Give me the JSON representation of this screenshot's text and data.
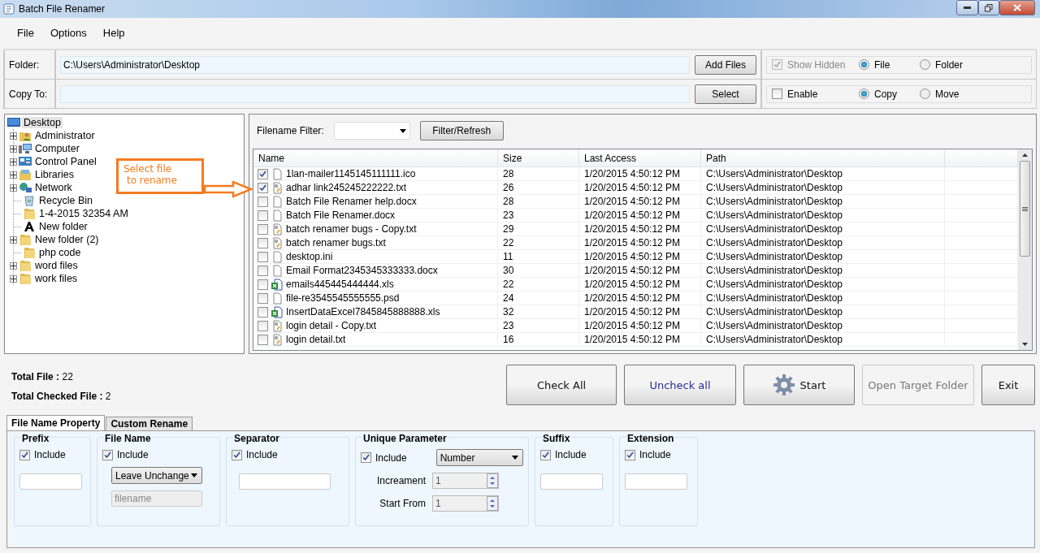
{
  "window": {
    "title": "Batch File Renamer"
  },
  "menu": [
    "File",
    "Options",
    "Help"
  ],
  "folder": {
    "label": "Folder:",
    "value": "C:\\Users\\Administrator\\Desktop",
    "button": "Add Files"
  },
  "copy_to": {
    "label": "Copy To:",
    "button": "Select"
  },
  "show_options": {
    "checkbox": {
      "label": "Show Hidden",
      "checked": true,
      "disabled": true
    },
    "choices": [
      {
        "label": "File",
        "selected": true
      },
      {
        "label": "Folder",
        "selected": false
      }
    ]
  },
  "copy_options": {
    "checkbox": {
      "label": "Enable",
      "checked": false,
      "disabled": false
    },
    "choices": [
      {
        "label": "Copy",
        "selected": true
      },
      {
        "label": "Move",
        "selected": false
      }
    ]
  },
  "tree": {
    "label": "Desktop",
    "kind": "desktop",
    "selected": true,
    "children": [
      {
        "label": "Administrator",
        "kind": "user",
        "expandable": true,
        "selected": false
      },
      {
        "label": "Computer",
        "kind": "computer",
        "expandable": true,
        "selected": false
      },
      {
        "label": "Control Panel",
        "kind": "control",
        "expandable": true,
        "selected": false
      },
      {
        "label": "Libraries",
        "kind": "library",
        "expandable": true,
        "selected": false
      },
      {
        "label": "Network",
        "kind": "network",
        "expandable": true,
        "selected": false
      },
      {
        "label": "Recycle Bin",
        "kind": "recycle",
        "expandable": false,
        "selected": false
      },
      {
        "label": "1-4-2015 32354 AM",
        "kind": "folder",
        "expandable": false,
        "selected": false
      },
      {
        "label": "New folder",
        "kind": "font",
        "expandable": false,
        "selected": false
      },
      {
        "label": "New folder (2)",
        "kind": "folder",
        "expandable": true,
        "selected": false
      },
      {
        "label": "php code",
        "kind": "folder",
        "expandable": false,
        "selected": false
      },
      {
        "label": "word files",
        "kind": "folder",
        "expandable": true,
        "selected": false
      },
      {
        "label": "work files",
        "kind": "folder",
        "expandable": true,
        "selected": false
      }
    ]
  },
  "callout": {
    "lines": [
      "Select file",
      "to rename"
    ]
  },
  "filter": {
    "label": "Filename Filter:",
    "button": "Filter/Refresh"
  },
  "table": {
    "columns": [
      "Name",
      "Size",
      "Last Access",
      "Path"
    ],
    "rows": [
      {
        "checked": true,
        "kind": "blank",
        "name": "1lan-mailer1145145111111.ico",
        "size": "28",
        "last_access": "1/20/2015 4:50:12 PM",
        "path": "C:\\Users\\Administrator\\Desktop"
      },
      {
        "checked": true,
        "kind": "text",
        "name": "adhar link245245222222.txt",
        "size": "26",
        "last_access": "1/20/2015 4:50:12 PM",
        "path": "C:\\Users\\Administrator\\Desktop"
      },
      {
        "checked": false,
        "kind": "blank",
        "name": "Batch File Renamer help.docx",
        "size": "28",
        "last_access": "1/20/2015 4:50:12 PM",
        "path": "C:\\Users\\Administrator\\Desktop"
      },
      {
        "checked": false,
        "kind": "blank",
        "name": "Batch File Renamer.docx",
        "size": "23",
        "last_access": "1/20/2015 4:50:12 PM",
        "path": "C:\\Users\\Administrator\\Desktop"
      },
      {
        "checked": false,
        "kind": "text",
        "name": "batch renamer bugs - Copy.txt",
        "size": "29",
        "last_access": "1/20/2015 4:50:12 PM",
        "path": "C:\\Users\\Administrator\\Desktop"
      },
      {
        "checked": false,
        "kind": "text",
        "name": "batch renamer bugs.txt",
        "size": "22",
        "last_access": "1/20/2015 4:50:12 PM",
        "path": "C:\\Users\\Administrator\\Desktop"
      },
      {
        "checked": false,
        "kind": "blank",
        "name": "desktop.ini",
        "size": "11",
        "last_access": "1/20/2015 4:50:12 PM",
        "path": "C:\\Users\\Administrator\\Desktop"
      },
      {
        "checked": false,
        "kind": "blank",
        "name": "Email Format2345345333333.docx",
        "size": "30",
        "last_access": "1/20/2015 4:50:12 PM",
        "path": "C:\\Users\\Administrator\\Desktop"
      },
      {
        "checked": false,
        "kind": "excel",
        "name": "emails445445444444.xls",
        "size": "22",
        "last_access": "1/20/2015 4:50:12 PM",
        "path": "C:\\Users\\Administrator\\Desktop"
      },
      {
        "checked": false,
        "kind": "blank",
        "name": "file-re3545545555555.psd",
        "size": "24",
        "last_access": "1/20/2015 4:50:12 PM",
        "path": "C:\\Users\\Administrator\\Desktop"
      },
      {
        "checked": false,
        "kind": "excel",
        "name": "InsertDataExcel7845845888888.xls",
        "size": "32",
        "last_access": "1/20/2015 4:50:12 PM",
        "path": "C:\\Users\\Administrator\\Desktop"
      },
      {
        "checked": false,
        "kind": "text",
        "name": "login detail - Copy.txt",
        "size": "23",
        "last_access": "1/20/2015 4:50:12 PM",
        "path": "C:\\Users\\Administrator\\Desktop"
      },
      {
        "checked": false,
        "kind": "text",
        "name": "login detail.txt",
        "size": "16",
        "last_access": "1/20/2015 4:50:12 PM",
        "path": "C:\\Users\\Administrator\\Desktop"
      }
    ]
  },
  "totals": [
    {
      "label": "Total File :",
      "value": "22"
    },
    {
      "label": "Total Checked File :",
      "value": "2"
    }
  ],
  "actions": [
    {
      "label": "Check All",
      "kind": "plain",
      "disabled": false
    },
    {
      "label": "Uncheck all",
      "kind": "link",
      "disabled": false
    },
    {
      "label": "Start",
      "kind": "gear",
      "disabled": false
    },
    {
      "label": "Open Target Folder",
      "kind": "plain",
      "disabled": true
    },
    {
      "label": "Exit",
      "kind": "plain",
      "disabled": false
    }
  ],
  "tabs": [
    {
      "label": "File Name Property",
      "selected": true
    },
    {
      "label": "Custom Rename",
      "selected": false
    }
  ],
  "groups": [
    {
      "title": "Prefix",
      "kind": "text",
      "include": {
        "label": "Include",
        "checked": true
      }
    },
    {
      "title": "File Name",
      "kind": "select",
      "include": {
        "label": "Include",
        "checked": true
      },
      "select": "Leave Unchange",
      "placeholder": "filename"
    },
    {
      "title": "Separator",
      "kind": "text",
      "include": {
        "label": "Include",
        "checked": true
      }
    },
    {
      "title": "Unique Parameter",
      "kind": "unique",
      "include": {
        "label": "Include",
        "checked": true
      },
      "select": "Number",
      "spinners": [
        {
          "label": "Increament",
          "value": "1"
        },
        {
          "label": "Start From",
          "value": "1"
        }
      ]
    },
    {
      "title": "Suffix",
      "kind": "text",
      "include": {
        "label": "Include",
        "checked": true
      }
    },
    {
      "title": "Extension",
      "kind": "text",
      "include": {
        "label": "Include",
        "checked": true
      }
    }
  ]
}
